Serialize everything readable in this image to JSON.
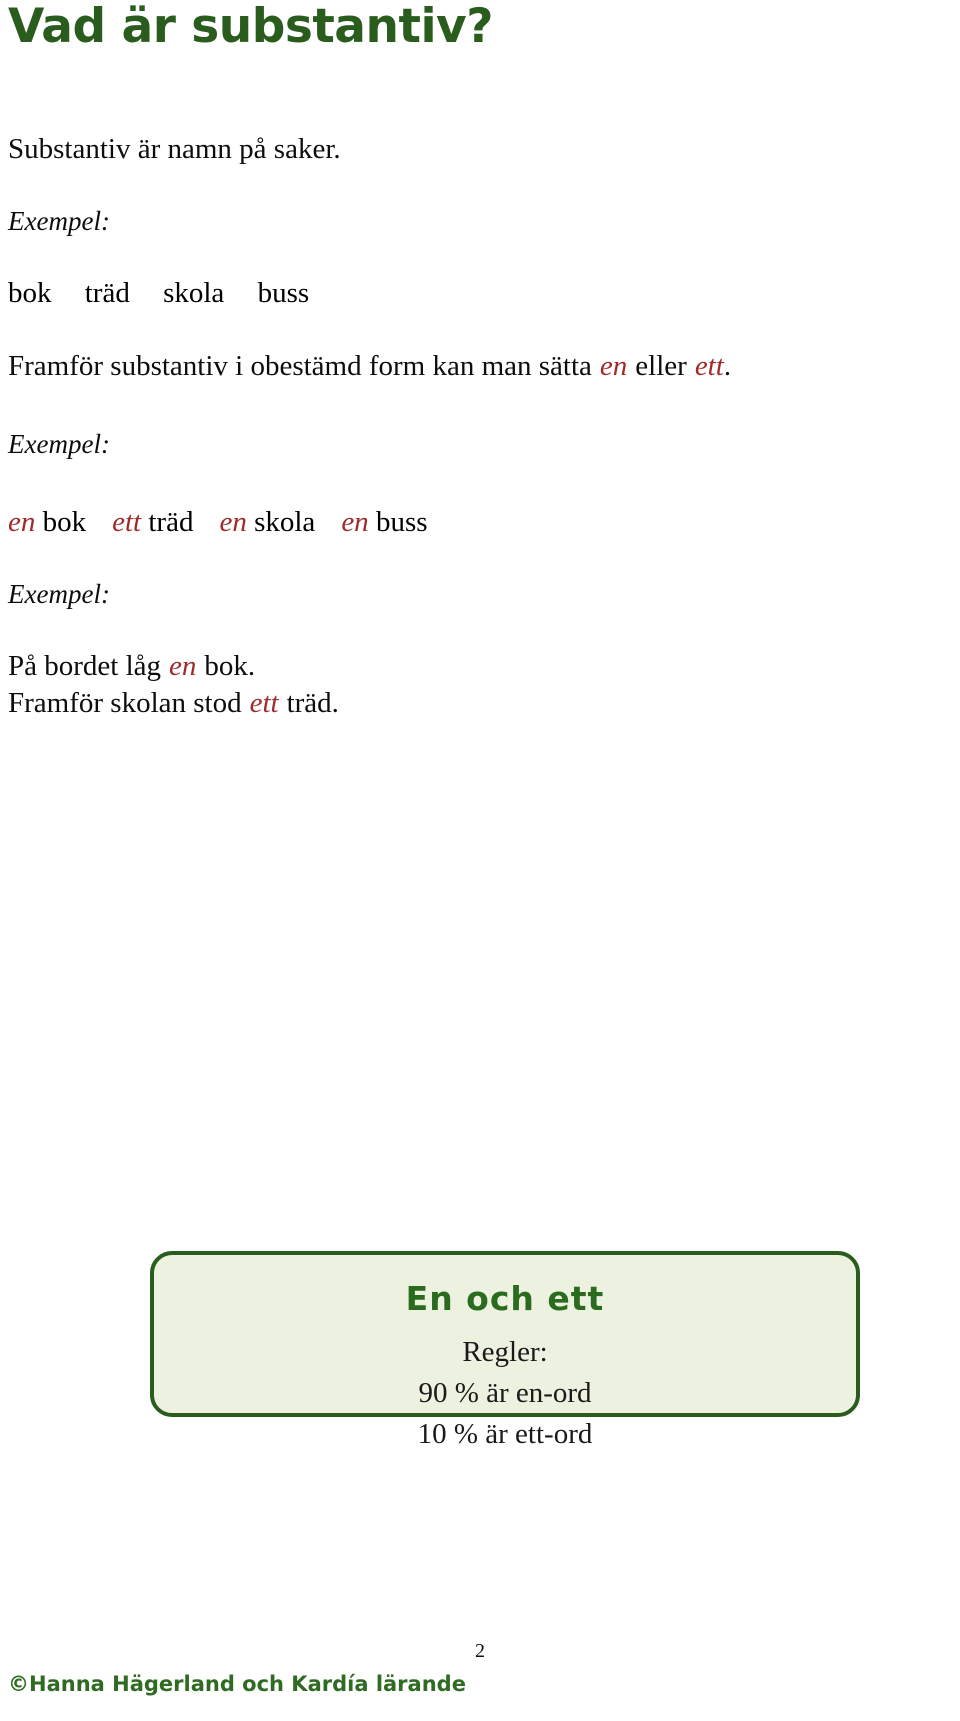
{
  "document": {
    "title": "Vad är substantiv?",
    "intro": "Substantiv är namn på saker.",
    "example_label_1": "Exempel:",
    "example_words": [
      "bok",
      "träd",
      "skola",
      "buss"
    ],
    "rule_sentence": {
      "part1": "Framför substantiv i obestämd form kan man sätta",
      "article_en": "en",
      "part2": "eller",
      "article_ett": "ett",
      "part3": "."
    },
    "example_label_2": "Exempel:",
    "article_examples": [
      {
        "article": "en",
        "noun": "bok"
      },
      {
        "article": "ett",
        "noun": "träd"
      },
      {
        "article": "en",
        "noun": "skola"
      },
      {
        "article": "en",
        "noun": "buss"
      }
    ],
    "example_label_3": "Exempel:",
    "sentences": [
      {
        "before": "På bordet låg",
        "article": "en",
        "after": "bok."
      },
      {
        "before": "Framför skolan stod",
        "article": "ett",
        "after": "träd."
      }
    ]
  },
  "rules_box": {
    "heading": "En och ett",
    "subheading": "Regler:",
    "rules": [
      "90 % är en-ord",
      "10 % är ett-ord"
    ]
  },
  "footer": {
    "page_number": "2",
    "copyright": "©Hanna Hägerland och Kardía lärande"
  },
  "colors": {
    "title_green": "#2a5c1e",
    "box_border_green": "#2a5c1e",
    "box_fill_green": "#edf1e0",
    "heading_green": "#2a6b1f",
    "article_red": "#9e2a2b",
    "footer_green": "#2f6b22"
  }
}
